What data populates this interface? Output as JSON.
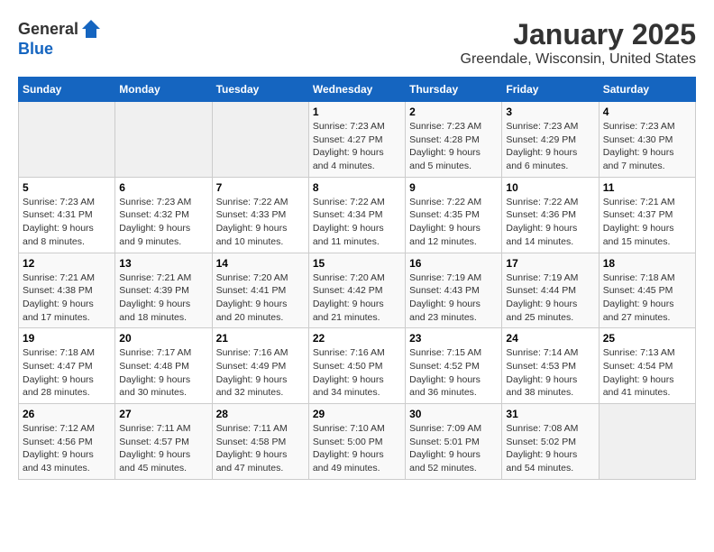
{
  "header": {
    "logo_general": "General",
    "logo_blue": "Blue",
    "title": "January 2025",
    "subtitle": "Greendale, Wisconsin, United States"
  },
  "days_of_week": [
    "Sunday",
    "Monday",
    "Tuesday",
    "Wednesday",
    "Thursday",
    "Friday",
    "Saturday"
  ],
  "weeks": [
    {
      "days": [
        {
          "number": "",
          "info": "",
          "empty": true
        },
        {
          "number": "",
          "info": "",
          "empty": true
        },
        {
          "number": "",
          "info": "",
          "empty": true
        },
        {
          "number": "1",
          "info": "Sunrise: 7:23 AM\nSunset: 4:27 PM\nDaylight: 9 hours and 4 minutes."
        },
        {
          "number": "2",
          "info": "Sunrise: 7:23 AM\nSunset: 4:28 PM\nDaylight: 9 hours and 5 minutes."
        },
        {
          "number": "3",
          "info": "Sunrise: 7:23 AM\nSunset: 4:29 PM\nDaylight: 9 hours and 6 minutes."
        },
        {
          "number": "4",
          "info": "Sunrise: 7:23 AM\nSunset: 4:30 PM\nDaylight: 9 hours and 7 minutes."
        }
      ]
    },
    {
      "days": [
        {
          "number": "5",
          "info": "Sunrise: 7:23 AM\nSunset: 4:31 PM\nDaylight: 9 hours and 8 minutes."
        },
        {
          "number": "6",
          "info": "Sunrise: 7:23 AM\nSunset: 4:32 PM\nDaylight: 9 hours and 9 minutes."
        },
        {
          "number": "7",
          "info": "Sunrise: 7:22 AM\nSunset: 4:33 PM\nDaylight: 9 hours and 10 minutes."
        },
        {
          "number": "8",
          "info": "Sunrise: 7:22 AM\nSunset: 4:34 PM\nDaylight: 9 hours and 11 minutes."
        },
        {
          "number": "9",
          "info": "Sunrise: 7:22 AM\nSunset: 4:35 PM\nDaylight: 9 hours and 12 minutes."
        },
        {
          "number": "10",
          "info": "Sunrise: 7:22 AM\nSunset: 4:36 PM\nDaylight: 9 hours and 14 minutes."
        },
        {
          "number": "11",
          "info": "Sunrise: 7:21 AM\nSunset: 4:37 PM\nDaylight: 9 hours and 15 minutes."
        }
      ]
    },
    {
      "days": [
        {
          "number": "12",
          "info": "Sunrise: 7:21 AM\nSunset: 4:38 PM\nDaylight: 9 hours and 17 minutes."
        },
        {
          "number": "13",
          "info": "Sunrise: 7:21 AM\nSunset: 4:39 PM\nDaylight: 9 hours and 18 minutes."
        },
        {
          "number": "14",
          "info": "Sunrise: 7:20 AM\nSunset: 4:41 PM\nDaylight: 9 hours and 20 minutes."
        },
        {
          "number": "15",
          "info": "Sunrise: 7:20 AM\nSunset: 4:42 PM\nDaylight: 9 hours and 21 minutes."
        },
        {
          "number": "16",
          "info": "Sunrise: 7:19 AM\nSunset: 4:43 PM\nDaylight: 9 hours and 23 minutes."
        },
        {
          "number": "17",
          "info": "Sunrise: 7:19 AM\nSunset: 4:44 PM\nDaylight: 9 hours and 25 minutes."
        },
        {
          "number": "18",
          "info": "Sunrise: 7:18 AM\nSunset: 4:45 PM\nDaylight: 9 hours and 27 minutes."
        }
      ]
    },
    {
      "days": [
        {
          "number": "19",
          "info": "Sunrise: 7:18 AM\nSunset: 4:47 PM\nDaylight: 9 hours and 28 minutes."
        },
        {
          "number": "20",
          "info": "Sunrise: 7:17 AM\nSunset: 4:48 PM\nDaylight: 9 hours and 30 minutes."
        },
        {
          "number": "21",
          "info": "Sunrise: 7:16 AM\nSunset: 4:49 PM\nDaylight: 9 hours and 32 minutes."
        },
        {
          "number": "22",
          "info": "Sunrise: 7:16 AM\nSunset: 4:50 PM\nDaylight: 9 hours and 34 minutes."
        },
        {
          "number": "23",
          "info": "Sunrise: 7:15 AM\nSunset: 4:52 PM\nDaylight: 9 hours and 36 minutes."
        },
        {
          "number": "24",
          "info": "Sunrise: 7:14 AM\nSunset: 4:53 PM\nDaylight: 9 hours and 38 minutes."
        },
        {
          "number": "25",
          "info": "Sunrise: 7:13 AM\nSunset: 4:54 PM\nDaylight: 9 hours and 41 minutes."
        }
      ]
    },
    {
      "days": [
        {
          "number": "26",
          "info": "Sunrise: 7:12 AM\nSunset: 4:56 PM\nDaylight: 9 hours and 43 minutes."
        },
        {
          "number": "27",
          "info": "Sunrise: 7:11 AM\nSunset: 4:57 PM\nDaylight: 9 hours and 45 minutes."
        },
        {
          "number": "28",
          "info": "Sunrise: 7:11 AM\nSunset: 4:58 PM\nDaylight: 9 hours and 47 minutes."
        },
        {
          "number": "29",
          "info": "Sunrise: 7:10 AM\nSunset: 5:00 PM\nDaylight: 9 hours and 49 minutes."
        },
        {
          "number": "30",
          "info": "Sunrise: 7:09 AM\nSunset: 5:01 PM\nDaylight: 9 hours and 52 minutes."
        },
        {
          "number": "31",
          "info": "Sunrise: 7:08 AM\nSunset: 5:02 PM\nDaylight: 9 hours and 54 minutes."
        },
        {
          "number": "",
          "info": "",
          "empty": true
        }
      ]
    }
  ]
}
